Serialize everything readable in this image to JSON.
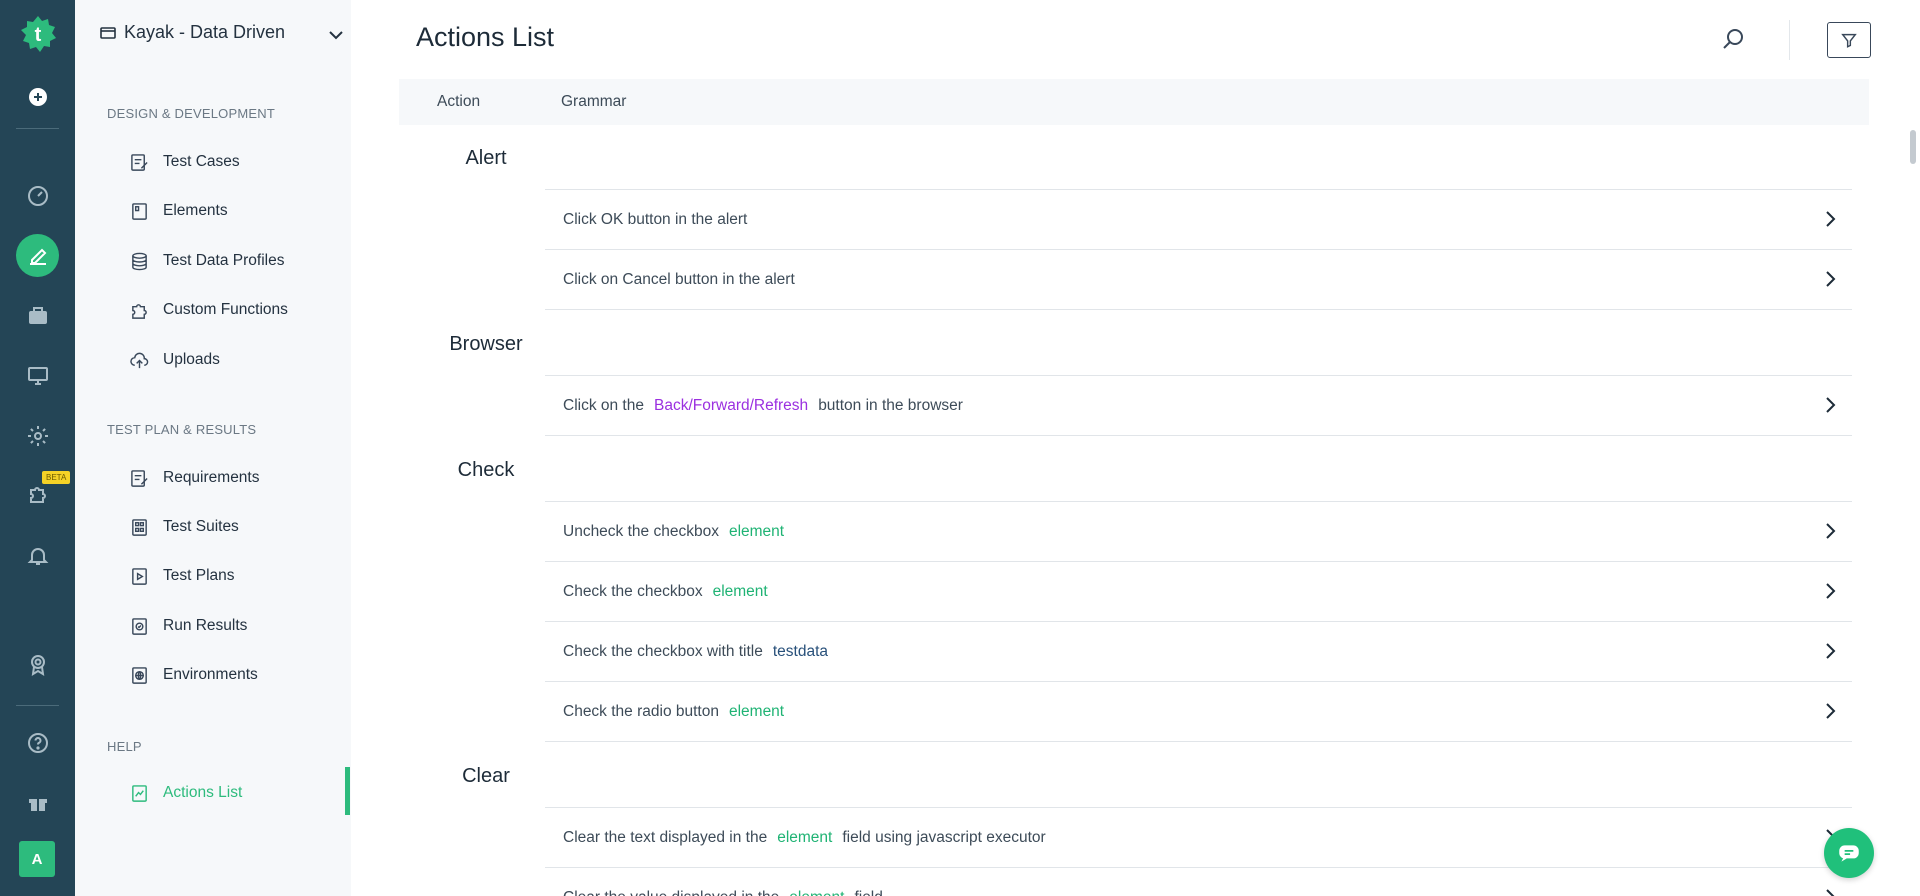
{
  "colors": {
    "rail_bg": "#244556",
    "accent": "#2dbb7d",
    "arg_purple": "#9b30e0",
    "arg_green": "#1fb374",
    "arg_navy": "#28507a"
  },
  "rail": {
    "items": [
      {
        "icon": "plus-circle-icon"
      },
      {
        "icon": "dashboard-icon"
      },
      {
        "icon": "pencil-icon"
      },
      {
        "icon": "briefcase-icon"
      },
      {
        "icon": "monitor-icon"
      },
      {
        "icon": "settings-icon"
      },
      {
        "icon": "puzzle-icon"
      },
      {
        "icon": "bell-icon"
      },
      {
        "icon": "award-icon"
      },
      {
        "icon": "help-icon"
      },
      {
        "icon": "gift-icon"
      }
    ],
    "beta_badge": "BETA",
    "avatar_letter": "A"
  },
  "sidebar": {
    "project_name": "Kayak - Data Driven",
    "sections": [
      {
        "label": "DESIGN & DEVELOPMENT",
        "items": [
          {
            "label": "Test Cases",
            "icon": "test-cases-icon"
          },
          {
            "label": "Elements",
            "icon": "elements-icon"
          },
          {
            "label": "Test Data Profiles",
            "icon": "database-icon"
          },
          {
            "label": "Custom Functions",
            "icon": "puzzle-icon"
          },
          {
            "label": "Uploads",
            "icon": "upload-cloud-icon"
          }
        ]
      },
      {
        "label": "TEST PLAN & RESULTS",
        "items": [
          {
            "label": "Requirements",
            "icon": "requirements-icon"
          },
          {
            "label": "Test Suites",
            "icon": "test-suites-icon"
          },
          {
            "label": "Test Plans",
            "icon": "test-plans-icon"
          },
          {
            "label": "Run Results",
            "icon": "run-results-icon"
          },
          {
            "label": "Environments",
            "icon": "globe-icon"
          }
        ]
      },
      {
        "label": "HELP",
        "items": [
          {
            "label": "Actions List",
            "icon": "actions-list-icon",
            "active": true
          }
        ]
      }
    ]
  },
  "main": {
    "title": "Actions List",
    "table_headers": {
      "action": "Action",
      "grammar": "Grammar"
    },
    "groups": [
      {
        "name": "Alert",
        "rows": [
          {
            "parts": [
              {
                "t": "Click OK button in the alert"
              }
            ]
          },
          {
            "parts": [
              {
                "t": "Click on Cancel button in the alert"
              }
            ]
          }
        ]
      },
      {
        "name": "Browser",
        "rows": [
          {
            "parts": [
              {
                "t": "Click on the"
              },
              {
                "arg": "Back/Forward/Refresh",
                "color": "purple"
              },
              {
                "t": "button in the browser"
              }
            ]
          }
        ]
      },
      {
        "name": "Check",
        "rows": [
          {
            "parts": [
              {
                "t": "Uncheck the checkbox"
              },
              {
                "arg": "element",
                "color": "green"
              }
            ]
          },
          {
            "parts": [
              {
                "t": "Check the checkbox"
              },
              {
                "arg": "element",
                "color": "green"
              }
            ]
          },
          {
            "parts": [
              {
                "t": "Check the checkbox with title"
              },
              {
                "arg": "testdata",
                "color": "navy"
              }
            ]
          },
          {
            "parts": [
              {
                "t": "Check the radio button"
              },
              {
                "arg": "element",
                "color": "green"
              }
            ]
          }
        ]
      },
      {
        "name": "Clear",
        "rows": [
          {
            "parts": [
              {
                "t": "Clear the text displayed in the"
              },
              {
                "arg": "element",
                "color": "green"
              },
              {
                "t": "field using javascript executor"
              }
            ]
          },
          {
            "parts": [
              {
                "t": "Clear the value displayed in the"
              },
              {
                "arg": "element",
                "color": "green"
              },
              {
                "t": "field"
              }
            ]
          }
        ]
      }
    ]
  }
}
